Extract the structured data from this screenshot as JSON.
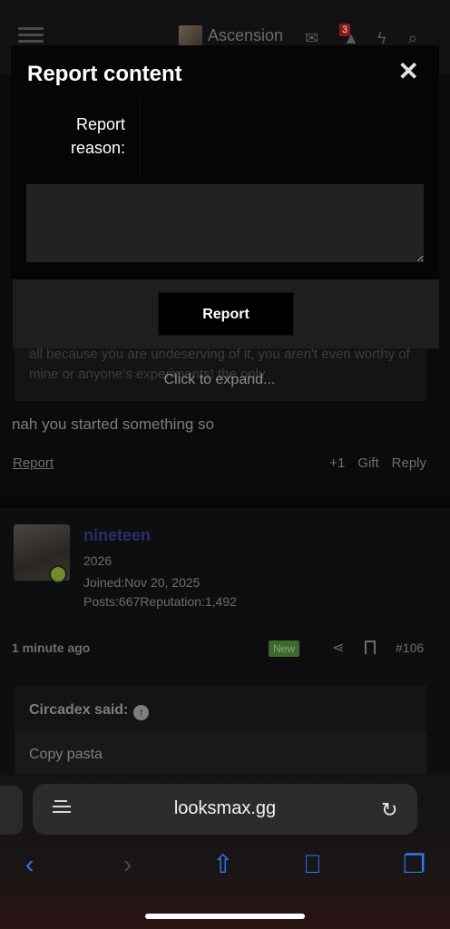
{
  "header": {
    "username": "Ascension",
    "alerts_badge": "3"
  },
  "modal": {
    "title": "Report content",
    "close_glyph": "✕",
    "reason_label": "Report reason:",
    "reason_value": "",
    "submit_label": "Report"
  },
  "post1": {
    "quote_fade_text": "all because you are undeserving of it, you aren't even worthy of mine or anyone's experiments! the only",
    "expand_label": "Click to expand...",
    "body": "nah you started something so",
    "report_link": "Report",
    "plus_one": "+1",
    "gift": "Gift",
    "reply": "Reply"
  },
  "post2": {
    "author": "nineteen",
    "rank": "2026",
    "joined_label": "Joined:",
    "joined_value": "Nov 20, 2025",
    "posts_label": "Posts:",
    "posts_value": "667",
    "rep_label": "Reputation:",
    "rep_value": "1,492",
    "time": "1 minute ago",
    "new_badge": "New",
    "post_number": "#106",
    "quote_author": "Circadex said:",
    "quote_text": "Copy pasta"
  },
  "browser": {
    "url": "looksmax.gg"
  },
  "icons": {
    "menu": "hamburger-icon",
    "mail": "mail-icon",
    "alerts": "bell-icon",
    "bolt": "bolt-icon",
    "search": "search-icon",
    "share": "share-icon",
    "bookmark": "bookmark-icon",
    "reader": "reader-icon",
    "reload": "reload-icon",
    "back": "back-icon",
    "forward": "forward-icon",
    "share_sheet": "share-sheet-icon",
    "bookmarks_book": "book-icon",
    "tabs": "tabs-icon"
  },
  "colors": {
    "accent_blue": "#2f7bf5",
    "online": "#6e8c2b",
    "new_badge": "#3c6a2c"
  }
}
